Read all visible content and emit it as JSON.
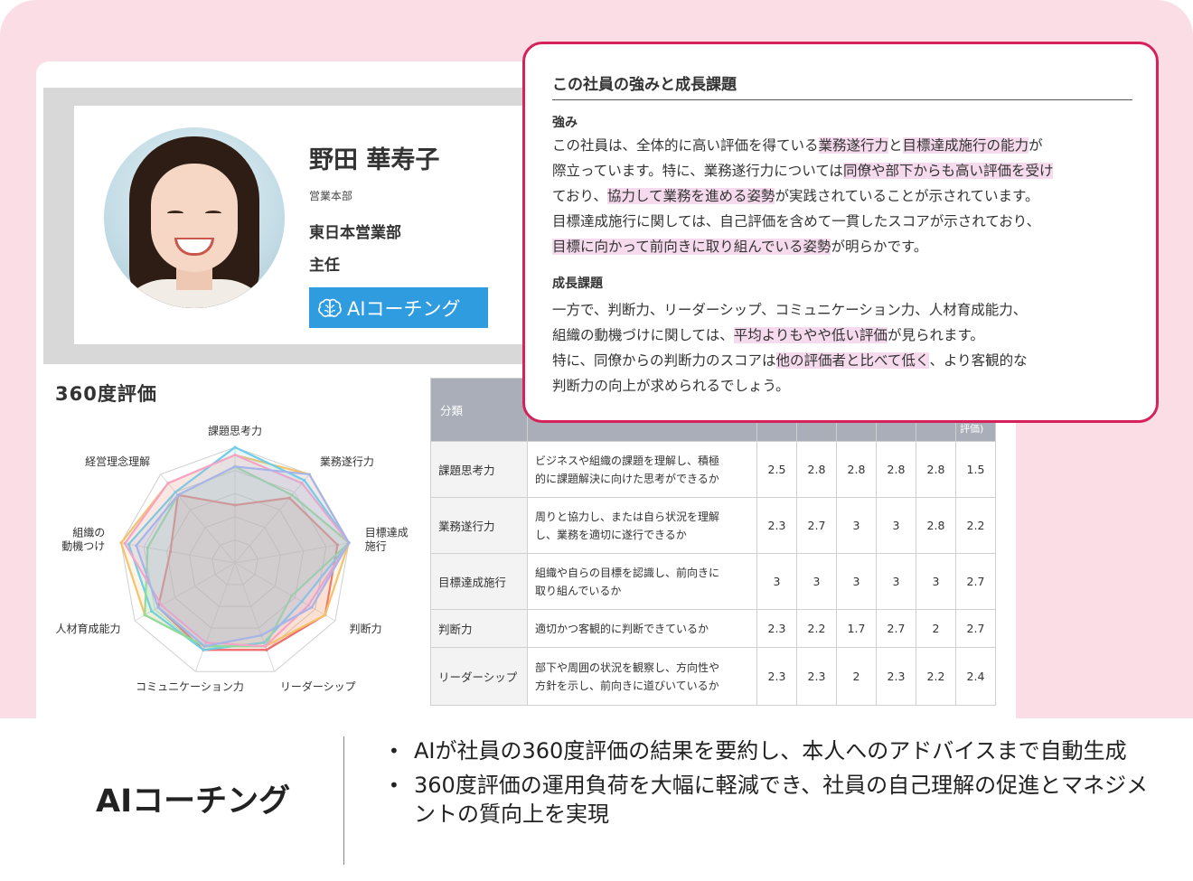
{
  "profile": {
    "name": "野田 華寿子",
    "department": "営業本部",
    "team": "東日本営業部",
    "title": "主任",
    "ai_button_label": "AIコーチング"
  },
  "evaluation": {
    "heading": "360度評価"
  },
  "chart_data": {
    "type": "radar",
    "axes": [
      "課題思考力",
      "業務遂行力",
      "目標達成施行",
      "判断力",
      "リーダーシップ",
      "コミュニケーション力",
      "人材育成能力",
      "組織の動機づけ",
      "経営理念理解"
    ],
    "axis_labels_display": [
      "課題思考力",
      "業務遂行力",
      "目標達成|施行",
      "判断力",
      "リーダーシップ",
      "コミュニケーション力",
      "人材育成能力",
      "組織の|動機つけ",
      "経営理念理解"
    ],
    "range": [
      0,
      3
    ],
    "grid_levels": 5,
    "series": [
      {
        "color": "#f06b6b",
        "values": [
          1.5,
          2.2,
          2.7,
          2.7,
          2.4,
          2.4,
          2.3,
          1.7,
          2.3
        ]
      },
      {
        "color": "#f5c26b",
        "values": [
          2.8,
          3,
          3,
          2.7,
          2.3,
          2.3,
          2.7,
          3,
          2.7
        ]
      },
      {
        "color": "#6ccfe6",
        "values": [
          3,
          2.8,
          3,
          2,
          2.2,
          2.4,
          2.5,
          2.8,
          2.4
        ]
      },
      {
        "color": "#8ddc9d",
        "values": [
          2.5,
          2.3,
          3,
          1.7,
          2.3,
          2.3,
          2.7,
          2.3,
          2.3
        ]
      },
      {
        "color": "#f5a3c7",
        "values": [
          2.8,
          2.7,
          3,
          2.2,
          2.3,
          2.2,
          2.2,
          2.9,
          2.7
        ]
      },
      {
        "color": "#a7b4e8",
        "values": [
          2.5,
          3,
          3,
          2.3,
          2,
          2.3,
          2.3,
          2.6,
          2.3
        ]
      }
    ]
  },
  "table": {
    "header_category": "分類",
    "header_last_partial": "評価)",
    "rows": [
      {
        "category": "課題思考力",
        "desc": [
          "ビジネスや組織の課題を理解し、積極",
          "的に課題解決に向けた思考ができるか"
        ],
        "scores": [
          "2.5",
          "2.8",
          "2.8",
          "2.8",
          "2.8",
          "1.5"
        ]
      },
      {
        "category": "業務遂行力",
        "desc": [
          "周りと協力し、または自ら状況を理解",
          "し、業務を適切に遂行できるか"
        ],
        "scores": [
          "2.3",
          "2.7",
          "3",
          "3",
          "2.8",
          "2.2"
        ]
      },
      {
        "category": "目標達成施行",
        "desc": [
          "組織や自らの目標を認識し、前向きに",
          "取り組んでいるか"
        ],
        "scores": [
          "3",
          "3",
          "3",
          "3",
          "3",
          "2.7"
        ]
      },
      {
        "category": "判断力",
        "desc": [
          "適切かつ客観的に判断できているか",
          ""
        ],
        "scores": [
          "2.3",
          "2.2",
          "1.7",
          "2.7",
          "2",
          "2.7"
        ]
      },
      {
        "category": "リーダーシップ",
        "desc": [
          "部下や周囲の状況を観察し、方向性や",
          "方針を示し、前向きに道びいているか"
        ],
        "scores": [
          "2.3",
          "2.3",
          "2",
          "2.3",
          "2.2",
          "2.4"
        ]
      }
    ]
  },
  "popup": {
    "title": "この社員の強みと成長課題",
    "strengths_heading": "強み",
    "strengths_lines": [
      [
        [
          "この社員は、全体的に高い評価を得ている",
          false
        ],
        [
          "業務遂行力",
          true
        ],
        [
          "と",
          false
        ],
        [
          "目標達成施行の能力",
          true
        ],
        [
          "が",
          false
        ]
      ],
      [
        [
          "際立っています。特に、業務遂行力については",
          false
        ],
        [
          "同僚や部下からも高い評価を受け",
          true
        ]
      ],
      [
        [
          "ており、",
          false
        ],
        [
          "協力して業務を進める姿勢",
          true
        ],
        [
          "が実践されていることが示されています。",
          false
        ]
      ],
      [
        [
          "目標達成施行に関しては、自己評価を含めて一貫したスコアが示されており、",
          false
        ]
      ],
      [
        [
          "目標に向かって前向きに取り組んでいる姿勢",
          true
        ],
        [
          "が明らかです。",
          false
        ]
      ]
    ],
    "challenges_heading": "成長課題",
    "challenges_lines": [
      [
        [
          "一方で、判断力、リーダーシップ、コミュニケーション力、人材育成能力、",
          false
        ]
      ],
      [
        [
          "組織の動機づけに関しては、",
          false
        ],
        [
          "平均よりもやや低い評価",
          true
        ],
        [
          "が見られます。",
          false
        ]
      ],
      [
        [
          "特に、同僚からの判断力のスコアは",
          false
        ],
        [
          "他の評価者と比べて低く",
          true
        ],
        [
          "、より客観的な",
          false
        ]
      ],
      [
        [
          "判断力の向上が求められるでしょう。",
          false
        ]
      ]
    ]
  },
  "feature": {
    "label": "AIコーチング",
    "bullets": [
      "AIが社員の360度評価の結果を要約し、本人へのアドバイスまで自動生成",
      "360度評価の運用負荷を大幅に軽減でき、社員の自己理解の促進とマネジメントの質向上を実現"
    ]
  }
}
